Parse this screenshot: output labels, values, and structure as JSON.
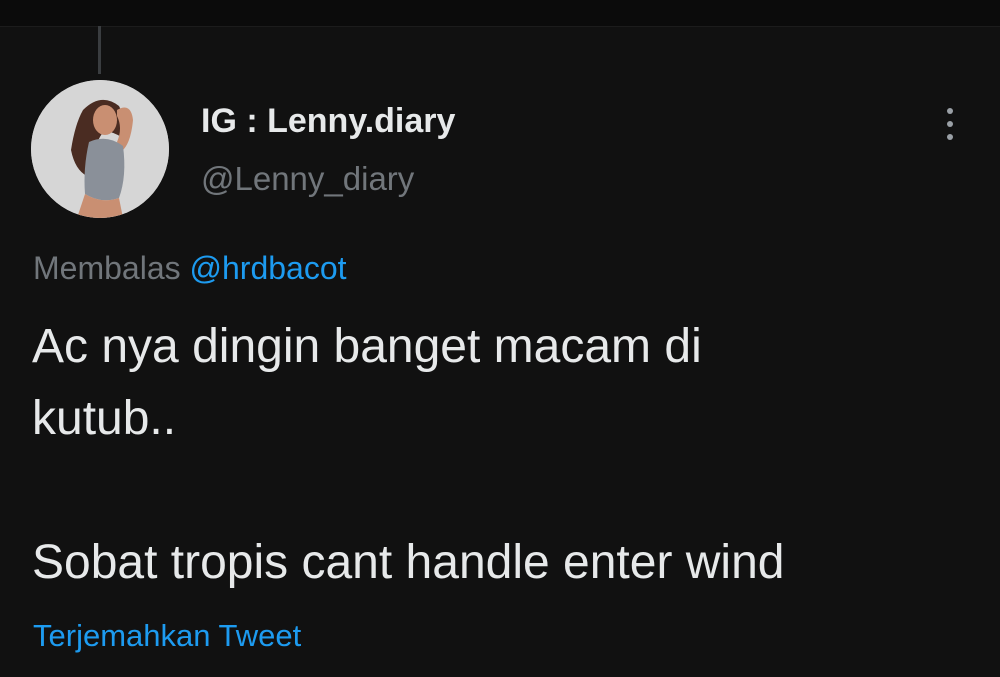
{
  "tweet": {
    "author": {
      "display_name": "IG : Lenny.diary",
      "handle": "@Lenny_diary"
    },
    "reply_prefix": "Membalas",
    "reply_to": "@hrdbacot",
    "text": "Ac nya dingin banget macam di\nkutub..\n\nSobat tropis cant handle enter wind",
    "translate_label": "Terjemahkan Tweet",
    "more_icon": "more-vertical-icon"
  },
  "colors": {
    "background": "#111111",
    "text_primary": "#e7e9ea",
    "text_secondary": "#71767b",
    "link": "#1d9bf0"
  }
}
